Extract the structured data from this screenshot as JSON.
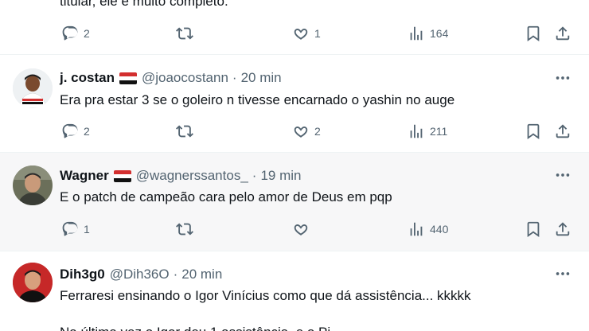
{
  "top_partial": {
    "text_tail": "titular, ele é muito completo.",
    "reply_count": "2",
    "like_count": "1",
    "view_count": "164"
  },
  "posts": [
    {
      "name": "j. costan",
      "handle": "@joaocostann",
      "time": "20 min",
      "text": "Era pra estar 3 se o goleiro n tivesse encarnado o yashin no auge",
      "reply_count": "2",
      "like_count": "2",
      "view_count": "211"
    },
    {
      "name": "Wagner",
      "handle": "@wagnerssantos_",
      "time": "19 min",
      "text": "E o patch de campeão cara pelo amor de Deus em pqp",
      "reply_count": "1",
      "like_count": "",
      "view_count": "440"
    },
    {
      "name": "Dih3g0",
      "handle": "@Dih36O",
      "time": "20 min",
      "text": "Ferraresi ensinando o Igor Vinícius como que dá assistência... kkkkk",
      "text_line2": "Na última vez o Igor deu 1 assistência, e o Pi..."
    }
  ],
  "icons": {
    "reply": "reply-icon",
    "repost": "repost-icon",
    "like": "heart-icon",
    "views": "views-icon",
    "bookmark": "bookmark-icon",
    "share": "share-icon",
    "more": "more-icon"
  },
  "colors": {
    "text": "#0f1419",
    "secondary": "#536471",
    "highlight_bg": "#f7f7f8"
  }
}
